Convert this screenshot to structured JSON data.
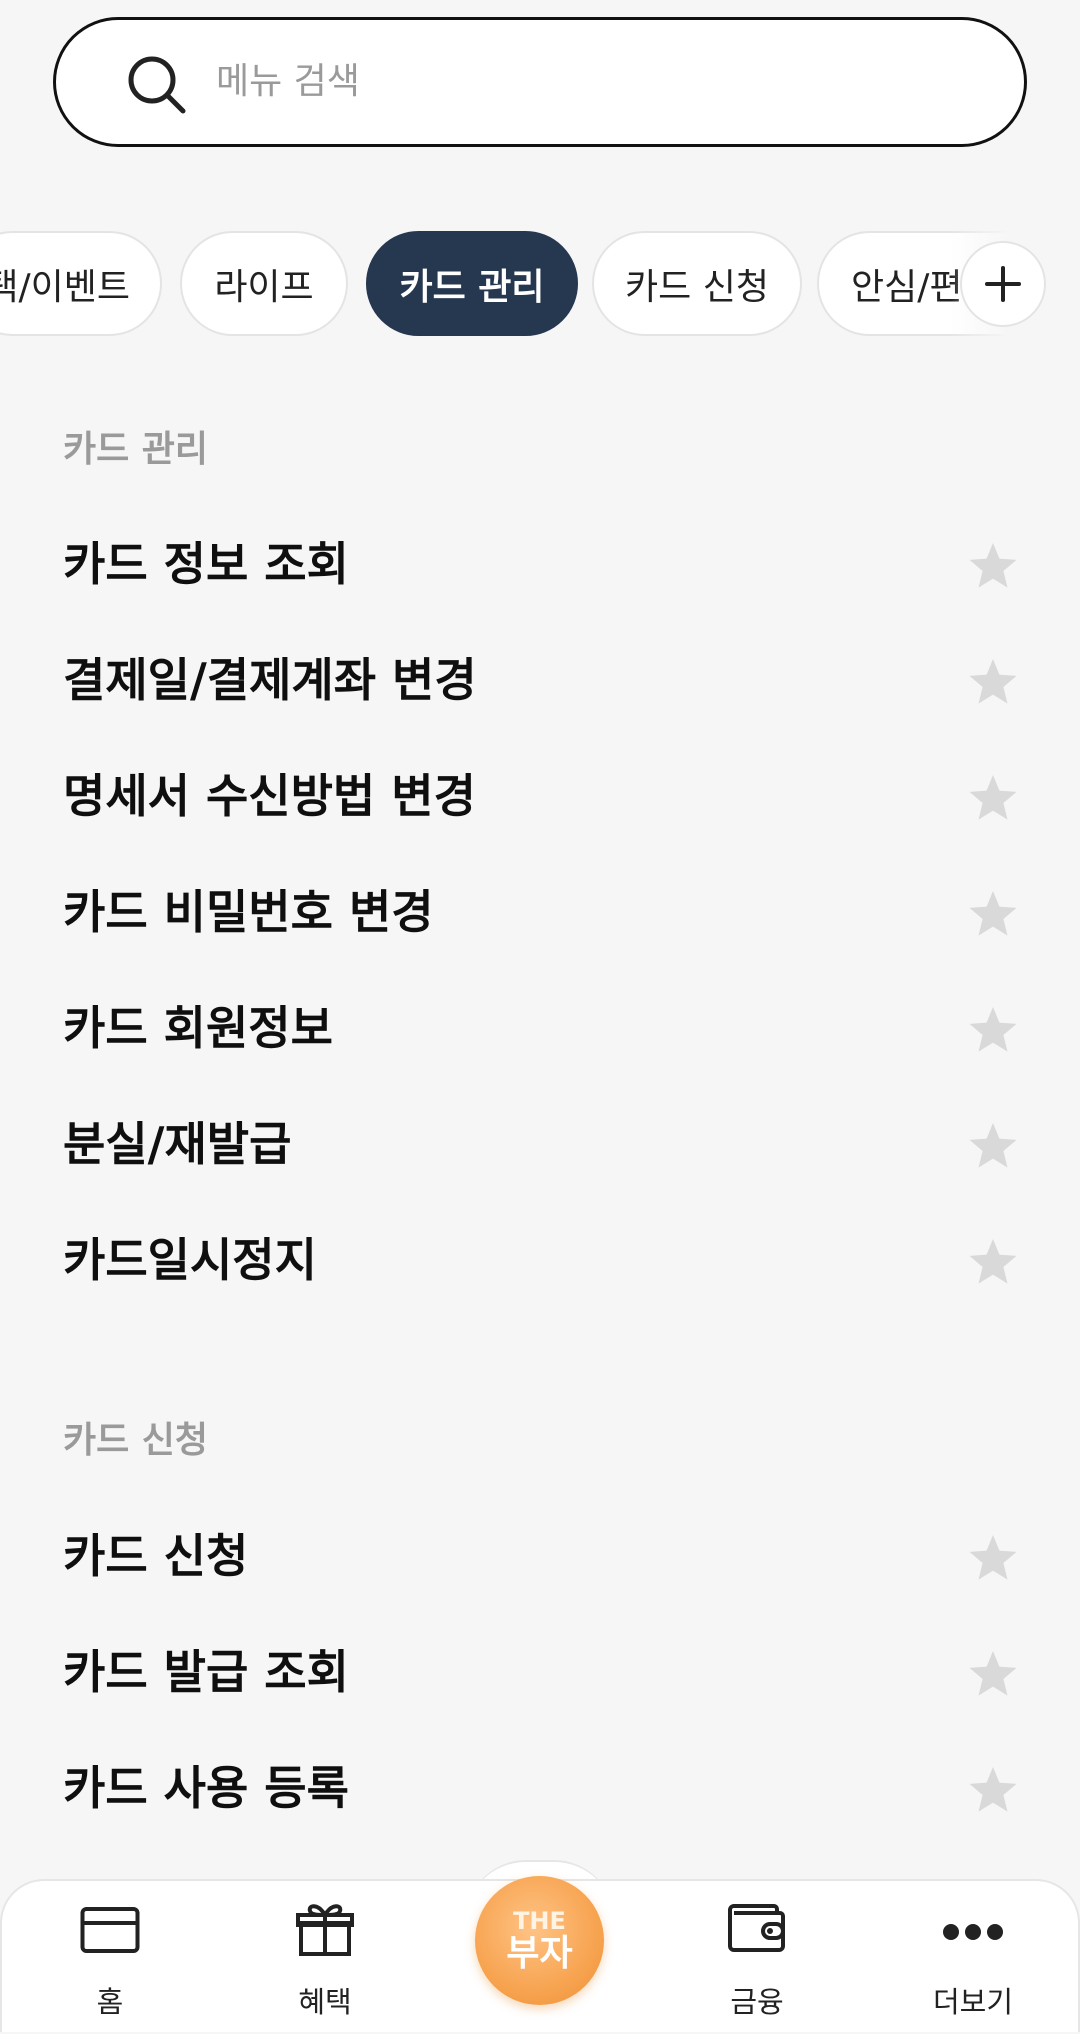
{
  "search": {
    "placeholder": "메뉴 검색"
  },
  "tabs": [
    {
      "label": "택/이벤트",
      "active": false
    },
    {
      "label": "라이프",
      "active": false
    },
    {
      "label": "카드 관리",
      "active": true
    },
    {
      "label": "카드 신청",
      "active": false
    },
    {
      "label": "안심/편",
      "active": false
    }
  ],
  "sections": [
    {
      "title": "카드 관리",
      "items": [
        "카드 정보 조회",
        "결제일/결제계좌 변경",
        "명세서 수신방법 변경",
        "카드 비밀번호 변경",
        "카드 회원정보",
        "분실/재발급",
        "카드일시정지"
      ]
    },
    {
      "title": "카드 신청",
      "items": [
        "카드 신청",
        "카드 발급 조회",
        "카드 사용 등록"
      ]
    }
  ],
  "bottom_nav": {
    "home": "홈",
    "benefits": "혜택",
    "center_top": "THE",
    "center_bottom": "부자",
    "finance": "금융",
    "more": "더보기"
  },
  "colors": {
    "active_tab": "#263750",
    "star_inactive": "#d9d9d9",
    "center_button": "#f7a451"
  },
  "icons": {
    "search": "search-icon",
    "add": "plus-icon",
    "favorite": "star-icon",
    "home": "card-icon",
    "benefits": "gift-icon",
    "finance": "wallet-icon",
    "more": "dots-icon"
  }
}
